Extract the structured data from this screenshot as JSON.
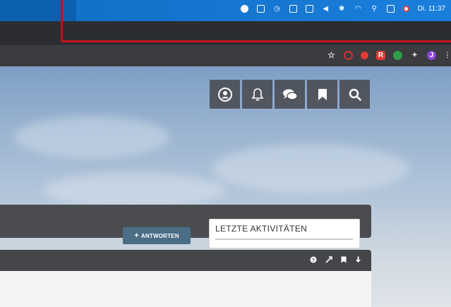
{
  "menubar": {
    "clock": "Di. 11:37",
    "icons": [
      "app-circle-icon",
      "screen-share-icon",
      "history-icon",
      "calendar-icon",
      "window-icon",
      "volume-icon",
      "bluetooth-icon",
      "wifi-icon",
      "search-icon",
      "control-center-icon",
      "screen-record-icon"
    ]
  },
  "browser": {
    "toolbar_icons": [
      "star-icon",
      "opera-icon",
      "extension-red-icon",
      "extension-r-icon",
      "extension-green-icon",
      "puzzle-icon",
      "profile-avatar",
      "menu-dots-icon"
    ],
    "profile_initial": "J",
    "ext_r_label": "R"
  },
  "site": {
    "header_icons": [
      "user-icon",
      "bell-icon",
      "chat-icon",
      "bookmark-icon",
      "search-icon"
    ],
    "reply_button": "ANTWORTEN",
    "activity_title": "LETZTE AKTIVITÄTEN",
    "thread_icons": [
      "help-icon",
      "expand-icon",
      "bookmark-icon",
      "download-icon"
    ]
  },
  "colors": {
    "menubar": "#1677d1",
    "annotation_red": "#c0121b",
    "reply_button": "#4b6d86"
  }
}
